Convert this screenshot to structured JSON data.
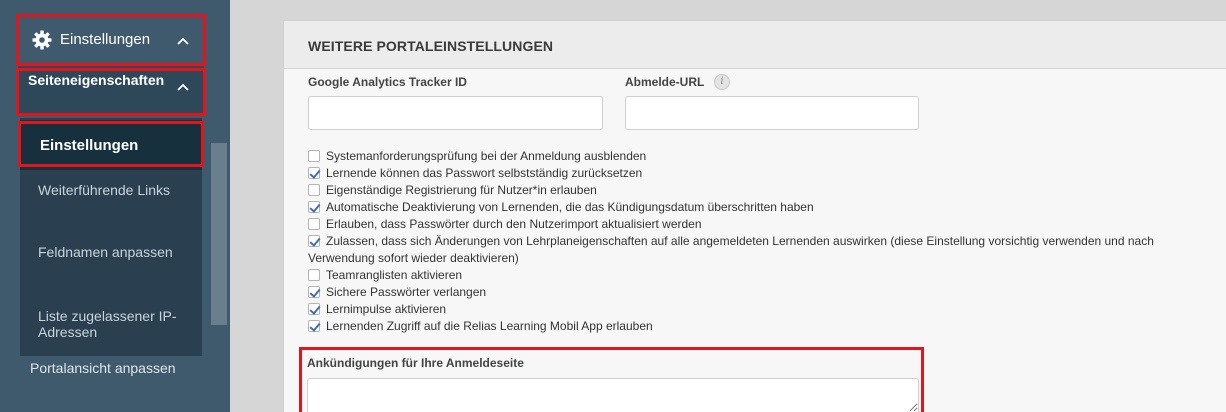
{
  "sidebar": {
    "header_label": "Einstellungen",
    "sub_label": "Seiteneigenschaften",
    "active_label": "Einstellungen",
    "items": [
      {
        "label": "Weiterführende Links"
      },
      {
        "label": "Feldnamen anpassen"
      },
      {
        "label": "Liste zugelassener IP-Adressen"
      }
    ],
    "bottom_label": "Portalansicht anpassen"
  },
  "panel": {
    "title": "WEITERE PORTALEINSTELLUNGEN",
    "ga_label": "Google Analytics Tracker ID",
    "ga_value": "",
    "logout_label": "Abmelde-URL",
    "logout_value": "",
    "options": [
      {
        "label": "Systemanforderungsprüfung bei der Anmeldung ausblenden",
        "checked": false
      },
      {
        "label": "Lernende können das Passwort selbstständig zurücksetzen",
        "checked": true
      },
      {
        "label": "Eigenständige Registrierung für Nutzer*in erlauben",
        "checked": false
      },
      {
        "label": "Automatische Deaktivierung von Lernenden, die das Kündigungsdatum überschritten haben",
        "checked": true
      },
      {
        "label": "Erlauben, dass Passwörter durch den Nutzerimport aktualisiert werden",
        "checked": false
      },
      {
        "label": "Zulassen, dass sich Änderungen von Lehrplaneigenschaften auf alle angemeldeten Lernenden auswirken (diese Einstellung vorsichtig verwenden und nach Verwendung sofort wieder deaktivieren)",
        "checked": true
      },
      {
        "label": "Teamranglisten aktivieren",
        "checked": false
      },
      {
        "label": "Sichere Passwörter verlangen",
        "checked": true
      },
      {
        "label": "Lernimpulse aktivieren",
        "checked": true
      },
      {
        "label": "Lernenden Zugriff auf die Relias Learning Mobil App erlauben",
        "checked": true
      }
    ],
    "announcement_label": "Ankündigungen für Ihre Anmeldeseite",
    "announcement_value": ""
  },
  "colors": {
    "sidebar_bg": "#3e5a6c",
    "sidebar_active": "#16303e",
    "highlight": "#e2141c",
    "checkmark": "#3f6fae"
  },
  "icons": {
    "settings": "gear-icon",
    "collapse": "chevron-up-icon",
    "info": "info-icon"
  }
}
